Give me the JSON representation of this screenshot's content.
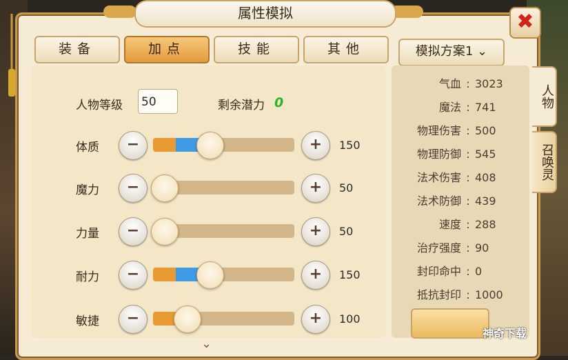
{
  "title": "属性模拟",
  "close_icon": "✖",
  "tabs": [
    {
      "label": "装备"
    },
    {
      "label": "加点"
    },
    {
      "label": "技能"
    },
    {
      "label": "其他"
    }
  ],
  "active_tab": "加点",
  "scheme": {
    "label": "模拟方案1"
  },
  "level": {
    "label": "人物等级",
    "value": "50"
  },
  "remaining": {
    "label": "剩余潜力",
    "value": "0"
  },
  "sliders": [
    {
      "label": "体质",
      "value": "150",
      "orange": 0.16,
      "blue": 0.4
    },
    {
      "label": "魔力",
      "value": "50",
      "orange": 0.08,
      "blue": 0.08
    },
    {
      "label": "力量",
      "value": "50",
      "orange": 0.08,
      "blue": 0.08
    },
    {
      "label": "耐力",
      "value": "150",
      "orange": 0.16,
      "blue": 0.4
    },
    {
      "label": "敏捷",
      "value": "100",
      "orange": 0.16,
      "blue": 0.24
    }
  ],
  "stats": [
    {
      "name": "气血",
      "value": "3023"
    },
    {
      "name": "魔法",
      "value": "741"
    },
    {
      "name": "物理伤害",
      "value": "500"
    },
    {
      "name": "物理防御",
      "value": "545"
    },
    {
      "name": "法术伤害",
      "value": "408"
    },
    {
      "name": "法术防御",
      "value": "439"
    },
    {
      "name": "速度",
      "value": "288"
    },
    {
      "name": "治疗强度",
      "value": "90"
    },
    {
      "name": "封印命中",
      "value": "0"
    },
    {
      "name": "抵抗封印",
      "value": "1000"
    }
  ],
  "side_tabs": [
    {
      "label": "人物"
    },
    {
      "label": "召唤灵"
    }
  ],
  "watermark": "神奇下载",
  "colors": {
    "active_tab": "#e39b3c",
    "fill_orange": "#e89a33",
    "fill_blue": "#3f9be6",
    "remaining_green": "#2ab22a",
    "close_red": "#d0241c"
  }
}
